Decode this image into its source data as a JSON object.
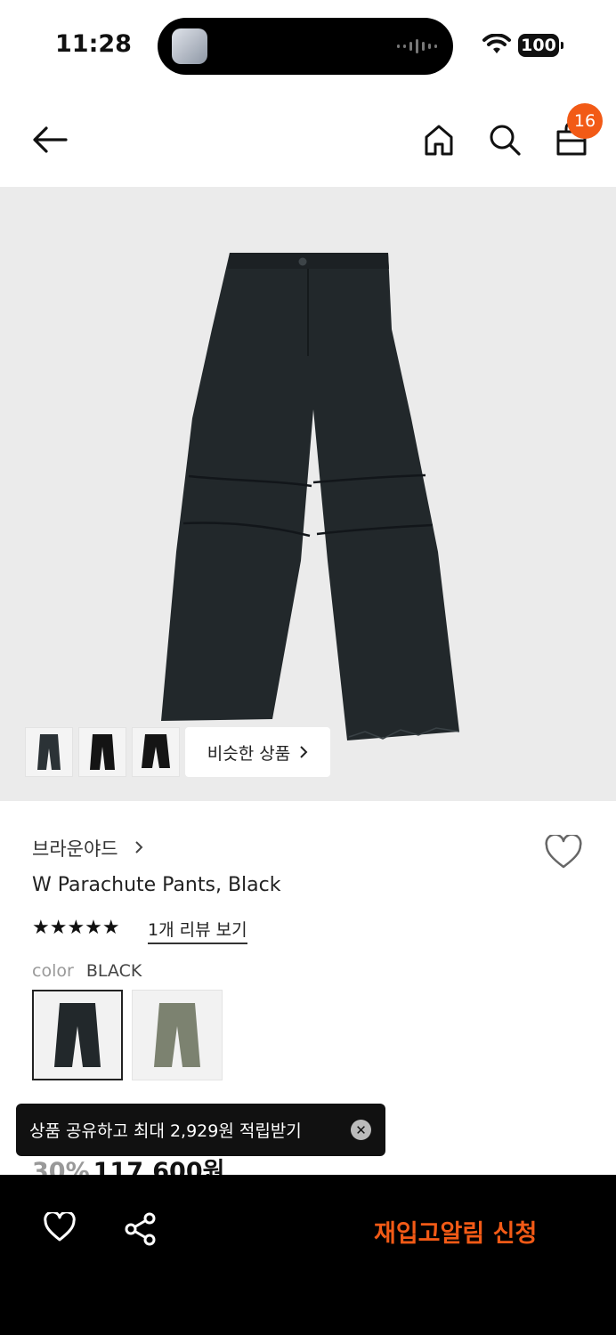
{
  "status_bar": {
    "time": "11:28",
    "battery": "100"
  },
  "nav": {
    "cart_count": "16"
  },
  "hero": {
    "similar_label": "비슷한 상품"
  },
  "product": {
    "brand": "브라운야드",
    "name": "W Parachute Pants, Black",
    "rating_stars": "★★★★★",
    "review_link": "1개 리뷰 보기",
    "color_label": "color",
    "color_value": "BLACK",
    "discount_rate": "30%",
    "price": "117,600원"
  },
  "toast": {
    "message": "상품 공유하고 최대 2,929원 적립받기"
  },
  "bottom_bar": {
    "restock_label": "재입고알림 신청"
  },
  "colors": {
    "accent": "#f25a16",
    "pants_black": "#22282b",
    "pants_khaki": "#7c8270"
  }
}
